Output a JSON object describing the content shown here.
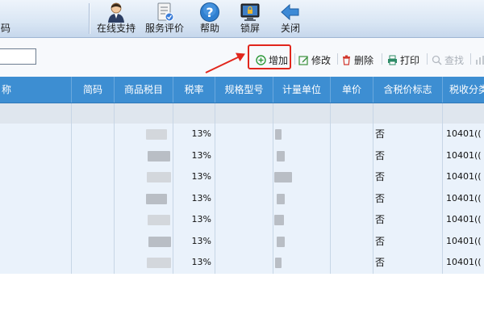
{
  "toolbar": {
    "partial_label": "码",
    "buttons": [
      {
        "label": "在线支持",
        "icon": "online-support-icon"
      },
      {
        "label": "服务评价",
        "icon": "service-evaluation-icon"
      },
      {
        "label": "帮助",
        "icon": "help-icon"
      },
      {
        "label": "锁屏",
        "icon": "lock-screen-icon"
      },
      {
        "label": "关闭",
        "icon": "close-arrow-icon"
      }
    ]
  },
  "search": {
    "value": ""
  },
  "actions": {
    "add": "增加",
    "edit": "修改",
    "delete": "删除",
    "print": "打印",
    "find": "查找"
  },
  "table": {
    "columns": [
      "称",
      "简码",
      "商品税目",
      "税率",
      "规格型号",
      "计量单位",
      "单价",
      "含税价标志",
      "税收分类"
    ],
    "rows": [
      {
        "rate": "13%",
        "tax_flag": "否",
        "tax_code": "10401(("
      },
      {
        "rate": "13%",
        "tax_flag": "否",
        "tax_code": "10401(("
      },
      {
        "rate": "13%",
        "tax_flag": "否",
        "tax_code": "10401(("
      },
      {
        "rate": "13%",
        "tax_flag": "否",
        "tax_code": "10401(("
      },
      {
        "rate": "13%",
        "tax_flag": "否",
        "tax_code": "10401(("
      },
      {
        "rate": "13%",
        "tax_flag": "否",
        "tax_code": "10401(("
      },
      {
        "rate": "13%",
        "tax_flag": "否",
        "tax_code": "10401(("
      }
    ]
  },
  "colors": {
    "header_blue": "#3d8ed2",
    "highlight_red": "#e1261c",
    "row_bg": "#eaf2fb"
  }
}
